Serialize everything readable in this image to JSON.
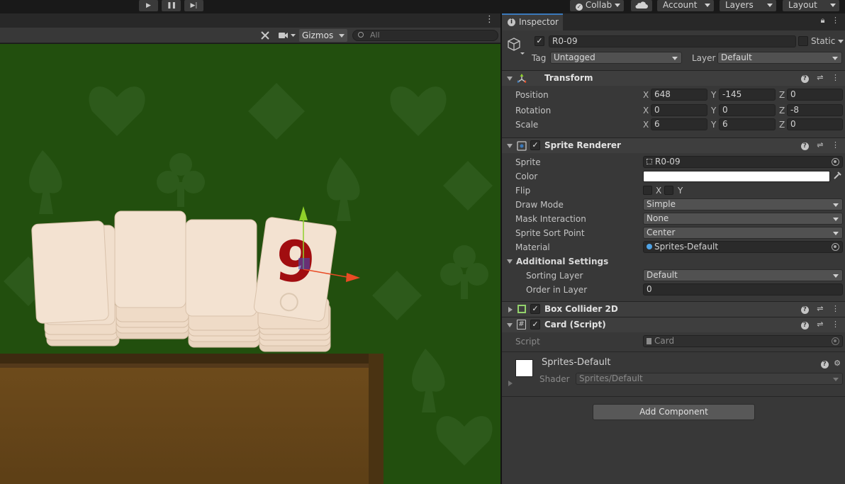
{
  "toolbar": {
    "play_icon": "play-icon",
    "pause_icon": "pause-icon",
    "step_icon": "step-icon",
    "collab_label": "Collab",
    "cloud_icon": "cloud-icon",
    "account_label": "Account",
    "layers_label": "Layers",
    "layout_label": "Layout"
  },
  "scene": {
    "menu_glyph": "⋮",
    "gizmos_label": "Gizmos",
    "search_placeholder": "All",
    "card_number": "9",
    "colors": {
      "background": "#224f0e",
      "suit_pattern": "#2f5e1c",
      "card_face": "#f1dfcd",
      "card_edge": "#dcc5ae",
      "number_red": "#a10d10",
      "table_wood": "#6b4a1b",
      "gizmo_up": "#8fd12a",
      "gizmo_right": "#e94a24"
    }
  },
  "inspector": {
    "tab_label": "Inspector",
    "object": {
      "name": "R0-09",
      "active": true,
      "static_label": "Static",
      "tag_label": "Tag",
      "tag_value": "Untagged",
      "layer_label": "Layer",
      "layer_value": "Default"
    },
    "transform": {
      "title": "Transform",
      "rows": [
        {
          "label": "Position",
          "x": "648",
          "y": "-145",
          "z": "0"
        },
        {
          "label": "Rotation",
          "x": "0",
          "y": "0",
          "z": "-8"
        },
        {
          "label": "Scale",
          "x": "6",
          "y": "6",
          "z": "0"
        }
      ],
      "axes": [
        "X",
        "Y",
        "Z"
      ]
    },
    "sprite_renderer": {
      "title": "Sprite Renderer",
      "sprite_label": "Sprite",
      "sprite_value": "R0-09",
      "color_label": "Color",
      "color_value": "#ffffff",
      "flip_label": "Flip",
      "flip_x": "X",
      "flip_y": "Y",
      "draw_mode_label": "Draw Mode",
      "draw_mode_value": "Simple",
      "mask_label": "Mask Interaction",
      "mask_value": "None",
      "sort_point_label": "Sprite Sort Point",
      "sort_point_value": "Center",
      "material_label": "Material",
      "material_value": "Sprites-Default",
      "additional_label": "Additional Settings",
      "sorting_layer_label": "Sorting Layer",
      "sorting_layer_value": "Default",
      "order_label": "Order in Layer",
      "order_value": "0"
    },
    "box_collider": {
      "title": "Box Collider 2D"
    },
    "card_script": {
      "title": "Card (Script)",
      "script_label": "Script",
      "script_value": "Card"
    },
    "material": {
      "name": "Sprites-Default",
      "shader_label": "Shader",
      "shader_value": "Sprites/Default"
    },
    "add_component_label": "Add Component",
    "colors": {
      "accent_tab": "#3a79bb",
      "collider_green": "#93d36b"
    }
  }
}
